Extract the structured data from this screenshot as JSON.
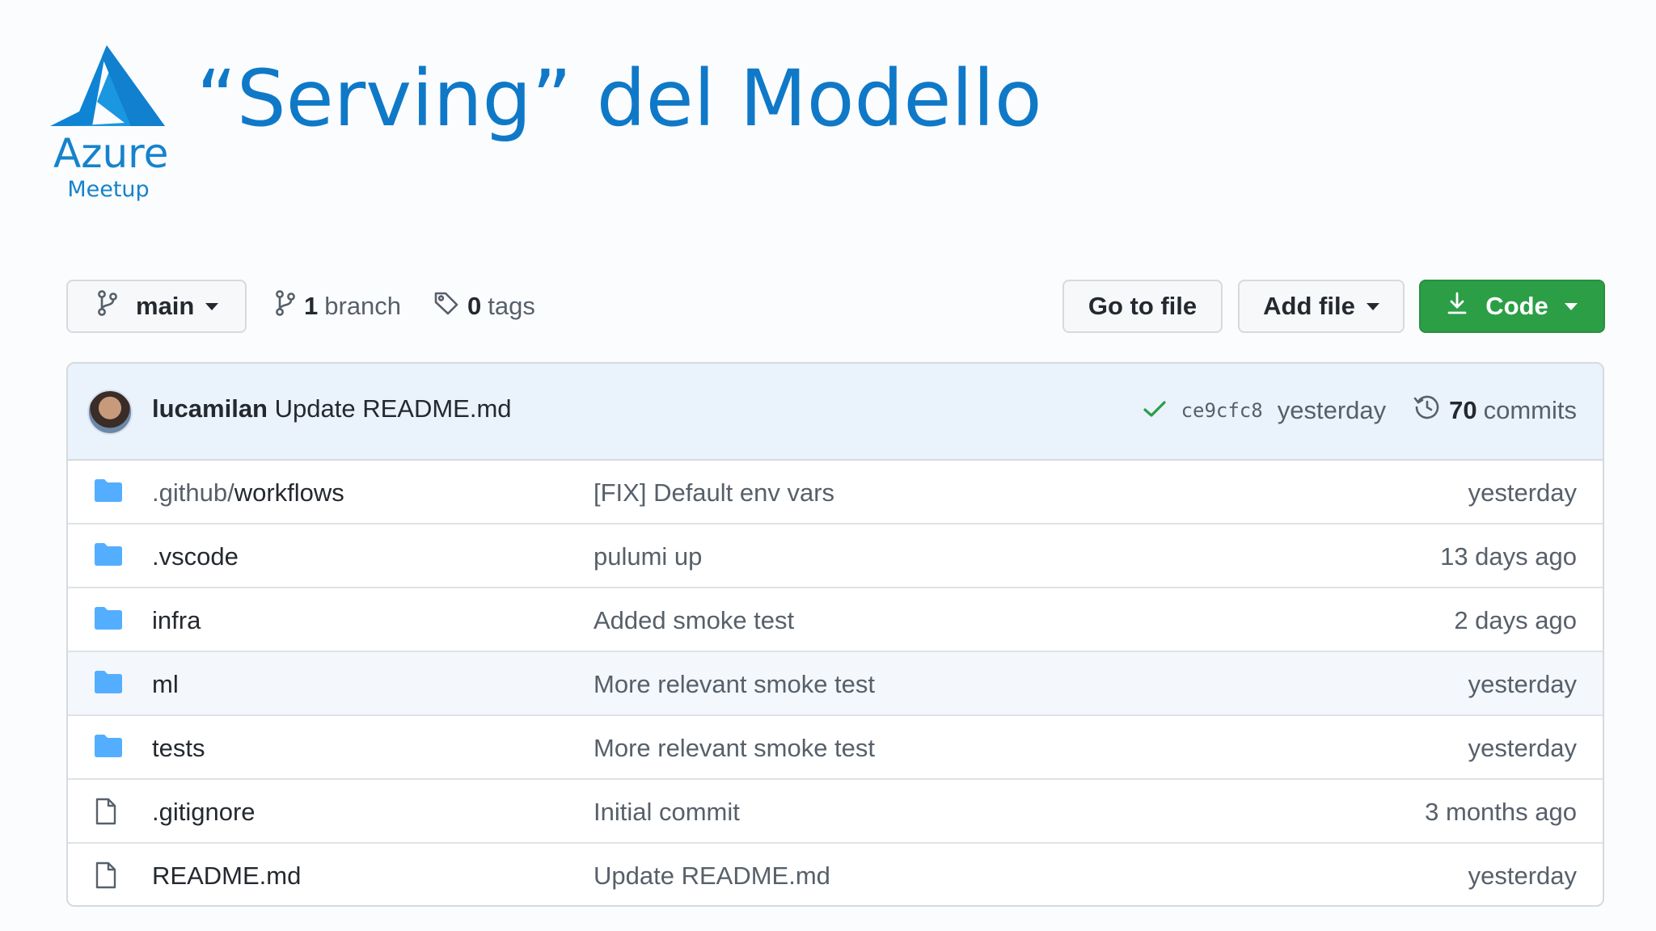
{
  "logo": {
    "word": "Azure",
    "sub": "Meetup",
    "color": "#1583cc"
  },
  "title": "“Serving” del Modello",
  "toolbar": {
    "branch_select_label": "main",
    "branch_count": "1",
    "branch_label": "branch",
    "tag_count": "0",
    "tag_label": "tags",
    "goto_label": "Go to file",
    "addfile_label": "Add file",
    "code_label": "Code",
    "code_color": "#2c9e46"
  },
  "latest_commit": {
    "author": "lucamilan",
    "message": "Update README.md",
    "status_icon": "check-icon",
    "sha": "ce9cfc8",
    "when": "yesterday",
    "commits_count": "70",
    "commits_label": "commits"
  },
  "files": [
    {
      "type": "folder",
      "name_dim": ".github/",
      "name": "workflows",
      "message": "[FIX] Default env vars",
      "date": "yesterday"
    },
    {
      "type": "folder",
      "name_dim": "",
      "name": ".vscode",
      "message": "pulumi up",
      "date": "13 days ago"
    },
    {
      "type": "folder",
      "name_dim": "",
      "name": "infra",
      "message": "Added smoke test",
      "date": "2 days ago"
    },
    {
      "type": "folder",
      "name_dim": "",
      "name": "ml",
      "message": "More relevant smoke test",
      "date": "yesterday"
    },
    {
      "type": "folder",
      "name_dim": "",
      "name": "tests",
      "message": "More relevant smoke test",
      "date": "yesterday"
    },
    {
      "type": "file",
      "name_dim": "",
      "name": ".gitignore",
      "message": "Initial commit",
      "date": "3 months ago"
    },
    {
      "type": "file",
      "name_dim": "",
      "name": "README.md",
      "message": "Update README.md",
      "date": "yesterday"
    }
  ]
}
